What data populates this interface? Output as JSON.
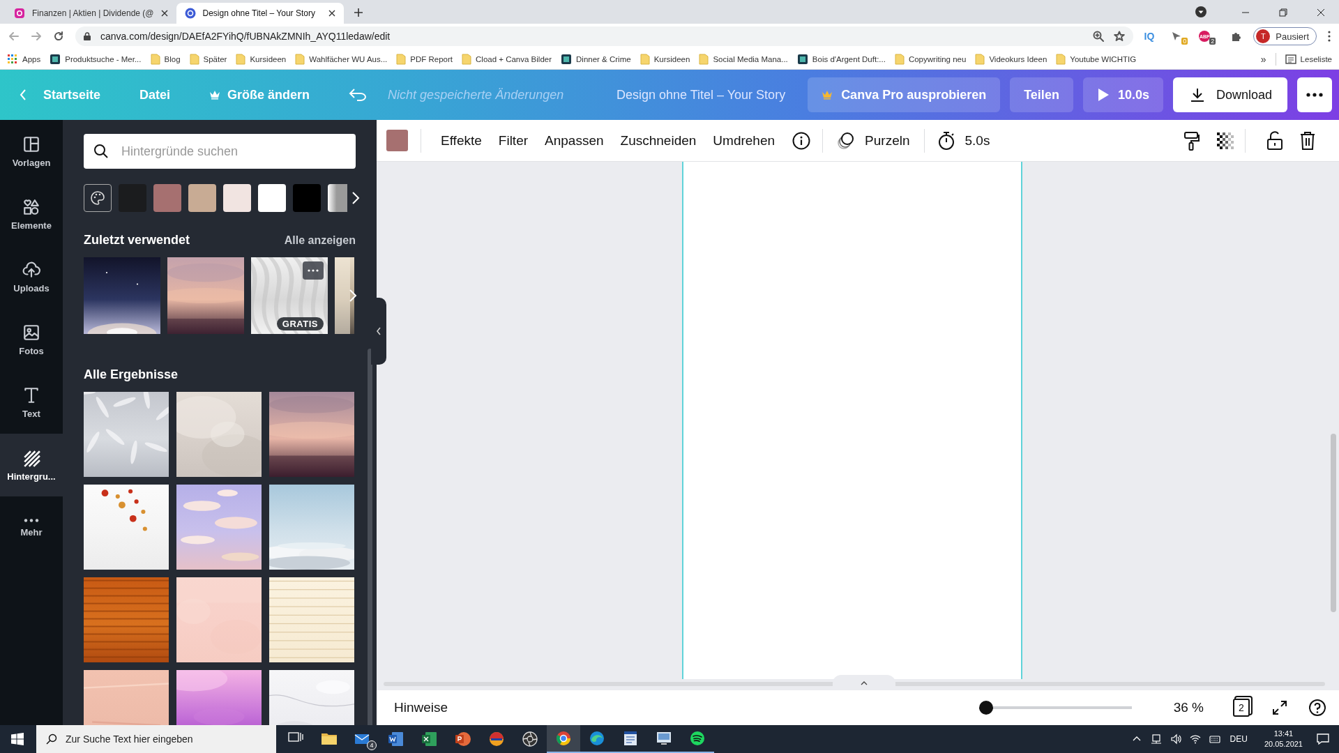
{
  "browser": {
    "tabs": [
      {
        "title": "Finanzen | Aktien | Dividende (@",
        "selected": false
      },
      {
        "title": "Design ohne Titel – Your Story",
        "selected": true
      }
    ],
    "url": "canva.com/design/DAEfA2FYihQ/fUBNAkZMNIh_AYQ11ledaw/edit",
    "extensions": [
      {
        "label": "IQ"
      },
      {
        "badge": "0"
      },
      {
        "label": "ABP",
        "badge": "2"
      }
    ],
    "profile": {
      "initial": "T",
      "status": "Pausiert"
    },
    "bookmarks": [
      {
        "label": "Apps",
        "kind": "apps"
      },
      {
        "label": "Produktsuche - Mer...",
        "kind": "site"
      },
      {
        "label": "Blog",
        "kind": "folder"
      },
      {
        "label": "Später",
        "kind": "folder"
      },
      {
        "label": "Kursideen",
        "kind": "folder"
      },
      {
        "label": "Wahlfächer WU Aus...",
        "kind": "folder"
      },
      {
        "label": "PDF Report",
        "kind": "folder"
      },
      {
        "label": "Cload + Canva Bilder",
        "kind": "folder"
      },
      {
        "label": "Dinner & Crime",
        "kind": "site"
      },
      {
        "label": "Kursideen",
        "kind": "folder"
      },
      {
        "label": "Social Media Mana...",
        "kind": "folder"
      },
      {
        "label": "Bois d'Argent Duft:...",
        "kind": "site"
      },
      {
        "label": "Copywriting neu",
        "kind": "folder"
      },
      {
        "label": "Videokurs Ideen",
        "kind": "folder"
      },
      {
        "label": "Youtube WICHTIG",
        "kind": "folder"
      }
    ],
    "more_bookmarks": "»",
    "reading_list": "Leseliste"
  },
  "header": {
    "home": "Startseite",
    "file": "Datei",
    "resize": "Größe ändern",
    "save_status": "Nicht gespeicherte Änderungen",
    "design_title": "Design ohne Titel – Your Story",
    "pro_button": "Canva Pro ausprobieren",
    "share_button": "Teilen",
    "play_button": "10.0s",
    "download_button": "Download"
  },
  "sidebar": {
    "items": [
      {
        "label": "Vorlagen",
        "selected": false
      },
      {
        "label": "Elemente",
        "selected": false
      },
      {
        "label": "Uploads",
        "selected": false
      },
      {
        "label": "Fotos",
        "selected": false
      },
      {
        "label": "Text",
        "selected": false
      },
      {
        "label": "Hintergru...",
        "selected": true
      },
      {
        "label": "Mehr",
        "selected": false
      }
    ]
  },
  "panel": {
    "search": {
      "placeholder": "Hintergründe suchen"
    },
    "swatches": [
      {
        "kind": "palette"
      },
      {
        "kind": "color",
        "color": "#1b1c1e"
      },
      {
        "kind": "color",
        "color": "#a67070"
      },
      {
        "kind": "color",
        "color": "#c8ab94"
      },
      {
        "kind": "color",
        "color": "#f1e4e1"
      },
      {
        "kind": "color",
        "color": "#ffffff"
      },
      {
        "kind": "color",
        "color": "#000000"
      },
      {
        "kind": "gradient",
        "color": "#9a9a9a"
      }
    ],
    "recent": {
      "heading": "Zuletzt verwendet",
      "see_all": "Alle anzeigen",
      "items": [
        {
          "kind": "picture"
        },
        {
          "kind": "picture"
        },
        {
          "kind": "picture",
          "badge": "GRATIS"
        },
        {
          "kind": "picture"
        }
      ]
    },
    "results": {
      "heading": "Alle Ergebnisse",
      "items": [
        {
          "kind": "picture"
        },
        {
          "kind": "picture"
        },
        {
          "kind": "picture"
        },
        {
          "kind": "picture"
        },
        {
          "kind": "picture"
        },
        {
          "kind": "picture"
        },
        {
          "kind": "picture"
        },
        {
          "kind": "picture"
        },
        {
          "kind": "picture"
        },
        {
          "kind": "picture"
        },
        {
          "kind": "picture"
        },
        {
          "kind": "picture"
        }
      ]
    }
  },
  "toolbar": {
    "color": "#a67070",
    "items": [
      "Effekte",
      "Filter",
      "Anpassen",
      "Zuschneiden",
      "Umdrehen"
    ],
    "animation": "Purzeln",
    "duration": "5.0s"
  },
  "footer": {
    "notes": "Hinweise",
    "zoom": {
      "level": 0.05
    },
    "zoom_label": "36 %",
    "page_count": "2"
  },
  "taskbar": {
    "search": {
      "placeholder": "Zur Suche Text hier eingeben"
    },
    "mail_badge": "4",
    "language": "DEU",
    "time": "13:41",
    "date": "20.05.2021"
  }
}
